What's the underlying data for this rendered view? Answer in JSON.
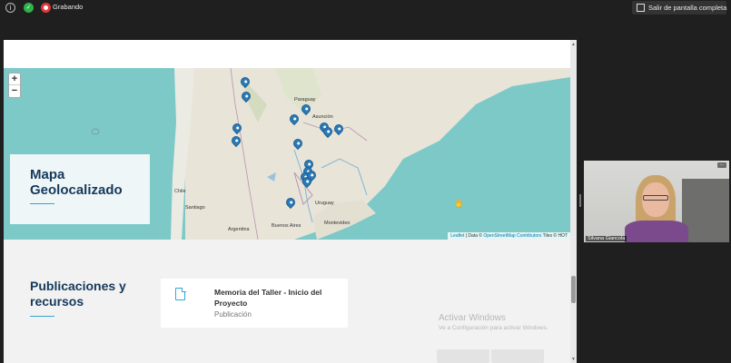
{
  "toolbar": {
    "recording_label": "Grabando",
    "fullscreen_label": "Salir de pantalla completa"
  },
  "map": {
    "zoom_in": "+",
    "zoom_out": "−",
    "labels": {
      "paraguay": "Paraguay",
      "asuncion": "Asunción",
      "chile": "Chile",
      "santiago": "Santiago",
      "uruguay": "Uruguay",
      "argentina": "Argentina",
      "buenos_aires": "Buenos Aires",
      "montevideo": "Montevideo"
    },
    "attribution": {
      "leaflet": "Leaflet",
      "data": " | Data © ",
      "osm": "OpenStreetMap Contributors",
      "tiles": " Tiles © HOT"
    },
    "marker_count": 16
  },
  "map_card": {
    "title": "Mapa Geolocalizado"
  },
  "publications": {
    "title": "Publicaciones y recursos",
    "items": [
      {
        "name": "Memoria del Taller - Inicio del Proyecto",
        "type": "Publicación"
      }
    ]
  },
  "windows_watermark": {
    "title": "Activar Windows",
    "subtitle": "Ve a Configuración para activar Windows."
  },
  "video": {
    "participant_name": "Silvana Giancola",
    "more_label": "···"
  }
}
